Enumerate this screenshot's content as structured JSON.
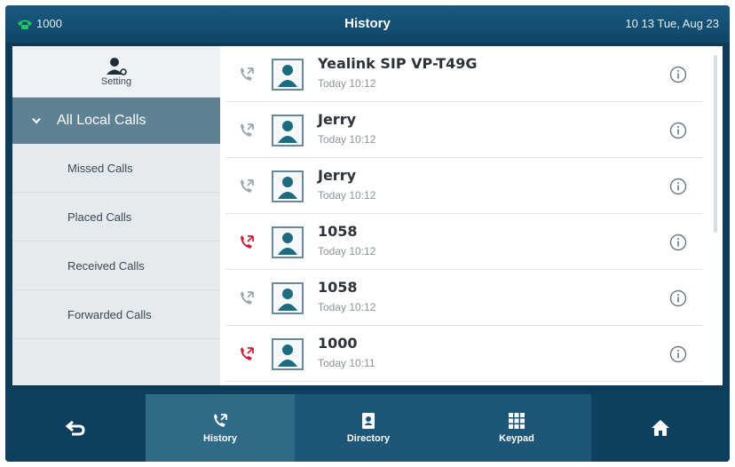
{
  "status": {
    "line": "1000",
    "title": "History",
    "datetime": "10 13 Tue, Aug 23"
  },
  "sidebar": {
    "setting_label": "Setting",
    "active_label": "All Local Calls",
    "items": [
      {
        "label": "Missed Calls"
      },
      {
        "label": "Placed Calls"
      },
      {
        "label": "Received Calls"
      },
      {
        "label": "Forwarded Calls"
      }
    ]
  },
  "calls": [
    {
      "name": "Yealink SIP VP-T49G",
      "time": "Today 10:12",
      "type": "received"
    },
    {
      "name": "Jerry",
      "time": "Today 10:12",
      "type": "received"
    },
    {
      "name": "Jerry",
      "time": "Today 10:12",
      "type": "received"
    },
    {
      "name": "1058",
      "time": "Today 10:12",
      "type": "missed"
    },
    {
      "name": "1058",
      "time": "Today 10:12",
      "type": "received"
    },
    {
      "name": "1000",
      "time": "Today 10:11",
      "type": "missed"
    }
  ],
  "nav": {
    "history": "History",
    "directory": "Directory",
    "keypad": "Keypad"
  },
  "colors": {
    "missed": "#c8203a",
    "received": "#9aa8b0",
    "accent": "#2f6a86"
  }
}
